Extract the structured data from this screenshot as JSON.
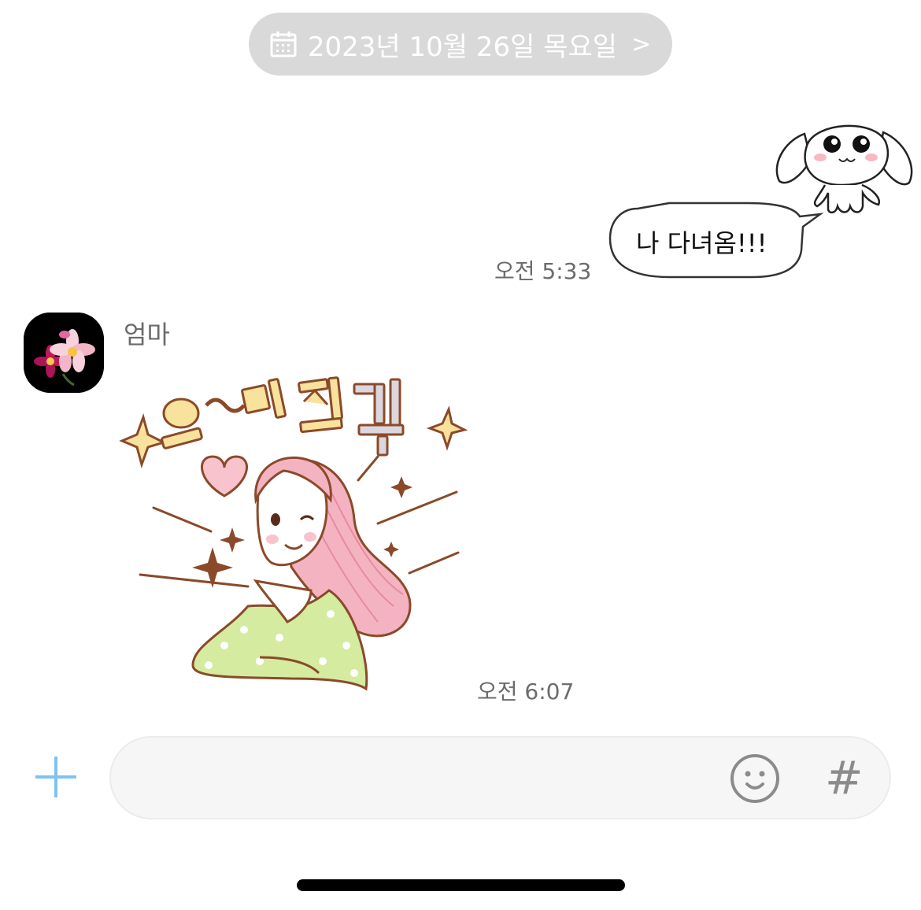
{
  "date_header": {
    "label": "2023년 10월 26일 목요일",
    "chevron": ">",
    "icon": "calendar-icon"
  },
  "messages": [
    {
      "direction": "sent",
      "sticker": "white-bunny-sticker",
      "text": "나 다녀옴!!!",
      "time": "오전 5:33"
    },
    {
      "direction": "received",
      "sender": "엄마",
      "avatar": "flower-avatar",
      "sticker": "girl-wink-sticker",
      "sticker_text": "오~멋진걸",
      "time": "오전 6:07"
    }
  ],
  "composer": {
    "value": "",
    "placeholder": "",
    "add_icon": "plus-icon",
    "emoji_icon": "emoji-icon",
    "hashtag_label": "#"
  },
  "colors": {
    "date_pill": "#d9d9d9",
    "accent": "#5aa9e6",
    "sticker_hair": "#f3a9b8",
    "sticker_shirt": "#cfe89a"
  }
}
